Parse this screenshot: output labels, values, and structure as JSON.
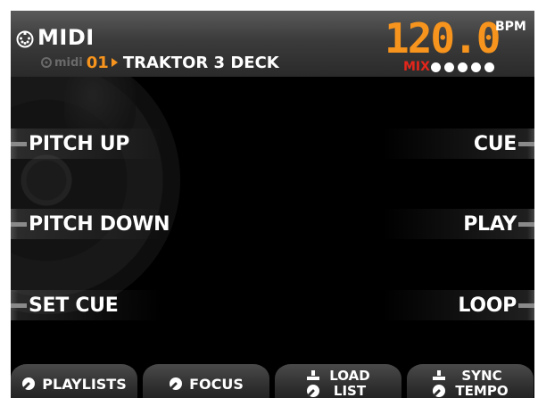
{
  "header": {
    "title": "MIDI",
    "device_label": "midi",
    "channel": "01",
    "mapping_name": "TRAKTOR 3 DECK",
    "bpm_value": "120.0",
    "bpm_label": "BPM",
    "mix_label": "MIX",
    "mix_level_dots": 5
  },
  "left_softkeys": [
    {
      "label": "PITCH UP"
    },
    {
      "label": "PITCH DOWN"
    },
    {
      "label": "SET CUE"
    }
  ],
  "right_softkeys": [
    {
      "label": "CUE"
    },
    {
      "label": "PLAY"
    },
    {
      "label": "LOOP"
    }
  ],
  "bottom_tabs": [
    {
      "label": "PLAYLISTS",
      "icon": "knob-icon"
    },
    {
      "label": "FOCUS",
      "icon": "knob-icon"
    },
    {
      "label_line1": "LOAD",
      "label_line2": "LIST",
      "icon": "push-knob-icon"
    },
    {
      "label_line1": "SYNC",
      "label_line2": "TEMPO",
      "icon": "push-knob-icon"
    }
  ],
  "colors": {
    "accent": "#f7941d",
    "mix": "#e3261b",
    "background": "#000000",
    "text": "#ffffff"
  }
}
